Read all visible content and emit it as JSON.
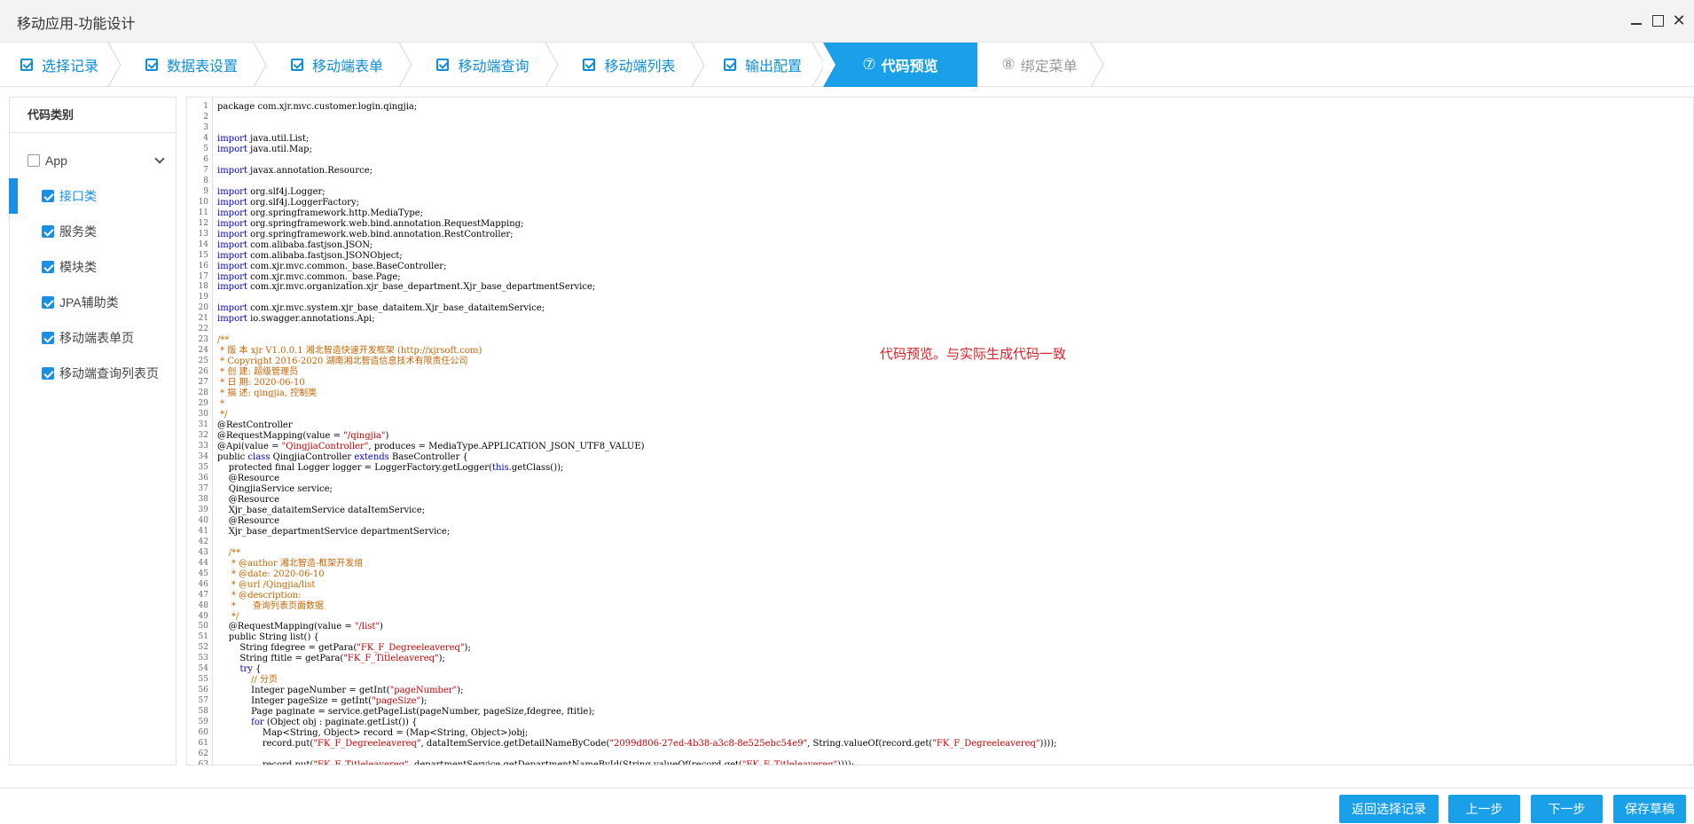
{
  "window": {
    "title": "移动应用-功能设计"
  },
  "steps": [
    {
      "label": "选择记录",
      "state": "done"
    },
    {
      "label": "数据表设置",
      "state": "done"
    },
    {
      "label": "移动端表单",
      "state": "done"
    },
    {
      "label": "移动端查询",
      "state": "done"
    },
    {
      "label": "移动端列表",
      "state": "done"
    },
    {
      "label": "输出配置",
      "state": "done"
    },
    {
      "label": "代码预览",
      "number": "⑦",
      "state": "active"
    },
    {
      "label": "绑定菜单",
      "number": "⑧",
      "state": "pending"
    }
  ],
  "left_panel": {
    "header": "代码类别",
    "root": {
      "label": "App",
      "checked": false,
      "expanded": true
    },
    "items": [
      {
        "label": "接口类",
        "checked": true,
        "selected": true
      },
      {
        "label": "服务类",
        "checked": true
      },
      {
        "label": "模块类",
        "checked": true
      },
      {
        "label": "JPA辅助类",
        "checked": true
      },
      {
        "label": "移动端表单页",
        "checked": true
      },
      {
        "label": "移动端查询列表页",
        "checked": true
      }
    ]
  },
  "code_note": "代码预览。与实际生成代码一致",
  "code_lines": [
    [
      [
        "t",
        "package com.xjr.mvc.customer.login.qingjia;"
      ]
    ],
    [
      [
        "t",
        ""
      ]
    ],
    [
      [
        "t",
        ""
      ]
    ],
    [
      [
        "k",
        "import"
      ],
      [
        "t",
        " java.util.List;"
      ]
    ],
    [
      [
        "k",
        "import"
      ],
      [
        "t",
        " java.util.Map;"
      ]
    ],
    [
      [
        "t",
        ""
      ]
    ],
    [
      [
        "k",
        "import"
      ],
      [
        "t",
        " javax.annotation.Resource;"
      ]
    ],
    [
      [
        "t",
        ""
      ]
    ],
    [
      [
        "k",
        "import"
      ],
      [
        "t",
        " org.slf4j.Logger;"
      ]
    ],
    [
      [
        "k",
        "import"
      ],
      [
        "t",
        " org.slf4j.LoggerFactory;"
      ]
    ],
    [
      [
        "k",
        "import"
      ],
      [
        "t",
        " org.springframework.http.MediaType;"
      ]
    ],
    [
      [
        "k",
        "import"
      ],
      [
        "t",
        " org.springframework.web.bind.annotation.RequestMapping;"
      ]
    ],
    [
      [
        "k",
        "import"
      ],
      [
        "t",
        " org.springframework.web.bind.annotation.RestController;"
      ]
    ],
    [
      [
        "k",
        "import"
      ],
      [
        "t",
        " com.alibaba.fastjson.JSON;"
      ]
    ],
    [
      [
        "k",
        "import"
      ],
      [
        "t",
        " com.alibaba.fastjson.JSONObject;"
      ]
    ],
    [
      [
        "k",
        "import"
      ],
      [
        "t",
        " com.xjr.mvc.common._base.BaseController;"
      ]
    ],
    [
      [
        "k",
        "import"
      ],
      [
        "t",
        " com.xjr.mvc.common._base.Page;"
      ]
    ],
    [
      [
        "k",
        "import"
      ],
      [
        "t",
        " com.xjr.mvc.organization.xjr_base_department.Xjr_base_departmentService;"
      ]
    ],
    [
      [
        "t",
        ""
      ]
    ],
    [
      [
        "k",
        "import"
      ],
      [
        "t",
        " com.xjr.mvc.system.xjr_base_dataitem.Xjr_base_dataitemService;"
      ]
    ],
    [
      [
        "k",
        "import"
      ],
      [
        "t",
        " io.swagger.annotations.Api;"
      ]
    ],
    [
      [
        "t",
        ""
      ]
    ],
    [
      [
        "c",
        "/**"
      ]
    ],
    [
      [
        "c",
        " * 版 本 xjr V1.0.0.1 湘北智造快速开发框架 (http://xjrsoft.com)"
      ]
    ],
    [
      [
        "c",
        " * Copyright 2016-2020 湖南湘北智造信息技术有限责任公司"
      ]
    ],
    [
      [
        "c",
        " * 创 建: 超级管理员"
      ]
    ],
    [
      [
        "c",
        " * 日 期: 2020-06-10"
      ]
    ],
    [
      [
        "c",
        " * 描 述: qingjia, 控制类"
      ]
    ],
    [
      [
        "c",
        " *"
      ]
    ],
    [
      [
        "c",
        " */"
      ]
    ],
    [
      [
        "t",
        "@RestController"
      ]
    ],
    [
      [
        "t",
        "@RequestMapping(value = "
      ],
      [
        "s",
        "\"/qingjia\""
      ],
      [
        "t",
        ")"
      ]
    ],
    [
      [
        "t",
        "@Api(value = "
      ],
      [
        "s",
        "\"QingjiaController\""
      ],
      [
        "t",
        ", produces = MediaType.APPLICATION_JSON_UTF8_VALUE)"
      ]
    ],
    [
      [
        "t",
        "public "
      ],
      [
        "k",
        "class"
      ],
      [
        "t",
        " QingjiaController "
      ],
      [
        "k",
        "extends"
      ],
      [
        "t",
        " BaseController {"
      ]
    ],
    [
      [
        "t",
        "    protected final Logger logger = LoggerFactory.getLogger("
      ],
      [
        "k",
        "this"
      ],
      [
        "t",
        ".getClass());"
      ]
    ],
    [
      [
        "t",
        "    @Resource"
      ]
    ],
    [
      [
        "t",
        "    QingjiaService service;"
      ]
    ],
    [
      [
        "t",
        "    @Resource"
      ]
    ],
    [
      [
        "t",
        "    Xjr_base_dataitemService dataItemService;"
      ]
    ],
    [
      [
        "t",
        "    @Resource"
      ]
    ],
    [
      [
        "t",
        "    Xjr_base_departmentService departmentService;"
      ]
    ],
    [
      [
        "t",
        ""
      ]
    ],
    [
      [
        "c",
        "    /**"
      ]
    ],
    [
      [
        "c",
        "     * @author 湘北智造-框架开发组"
      ]
    ],
    [
      [
        "c",
        "     * @date: 2020-06-10"
      ]
    ],
    [
      [
        "c",
        "     * @url /Qingjia/list"
      ]
    ],
    [
      [
        "c",
        "     * @description:"
      ]
    ],
    [
      [
        "c",
        "     *      查询列表页面数据"
      ]
    ],
    [
      [
        "c",
        "     */"
      ]
    ],
    [
      [
        "t",
        "    @RequestMapping(value = "
      ],
      [
        "s",
        "\"/list\""
      ],
      [
        "t",
        ")"
      ]
    ],
    [
      [
        "t",
        "    public String list() {"
      ]
    ],
    [
      [
        "t",
        "        String fdegree = getPara("
      ],
      [
        "s",
        "\"FK_F_Degreeleavereq\""
      ],
      [
        "t",
        ");"
      ]
    ],
    [
      [
        "t",
        "        String ftitle = getPara("
      ],
      [
        "s",
        "\"FK_F_Titleleavereq\""
      ],
      [
        "t",
        ");"
      ]
    ],
    [
      [
        "t",
        "        "
      ],
      [
        "k",
        "try"
      ],
      [
        "t",
        " {"
      ]
    ],
    [
      [
        "c",
        "            // 分页"
      ]
    ],
    [
      [
        "t",
        "            Integer pageNumber = getInt("
      ],
      [
        "s",
        "\"pageNumber\""
      ],
      [
        "t",
        ");"
      ]
    ],
    [
      [
        "t",
        "            Integer pageSize = getInt("
      ],
      [
        "s",
        "\"pageSize\""
      ],
      [
        "t",
        ");"
      ]
    ],
    [
      [
        "t",
        "            Page paginate = service.getPageList(pageNumber, pageSize,fdegree, ftitle);"
      ]
    ],
    [
      [
        "t",
        "            "
      ],
      [
        "k",
        "for"
      ],
      [
        "t",
        " (Object obj : paginate.getList()) {"
      ]
    ],
    [
      [
        "t",
        "                Map<String, Object> record = (Map<String, Object>)obj;"
      ]
    ],
    [
      [
        "t",
        "                record.put("
      ],
      [
        "s",
        "\"FK_F_Degreeleavereq\""
      ],
      [
        "t",
        ", dataItemService.getDetailNameByCode("
      ],
      [
        "s",
        "\"2099d806-27ed-4b38-a3c8-8e525ebc54e9\""
      ],
      [
        "t",
        ", String.valueOf(record.get("
      ],
      [
        "s",
        "\"FK_F_Degreeleavereq\""
      ],
      [
        "t",
        "))));"
      ]
    ],
    [
      [
        "t",
        ""
      ]
    ],
    [
      [
        "t",
        "                record.put("
      ],
      [
        "s",
        "\"FK_F_Titleleavereq\""
      ],
      [
        "t",
        ", departmentService.getDepartmentNameById(String.valueOf(record.get("
      ],
      [
        "s",
        "\"FK_F_Titleleavereq\""
      ],
      [
        "t",
        "))));"
      ]
    ]
  ],
  "footer": {
    "back_to_select": "返回选择记录",
    "prev": "上一步",
    "next": "下一步",
    "save_draft": "保存草稿"
  },
  "colors": {
    "accent": "#1aa0e8",
    "step_text": "#0d8fd8",
    "note": "#e0202a",
    "keyword": "#0000c8",
    "comment": "#c86400",
    "string": "#c80000"
  }
}
